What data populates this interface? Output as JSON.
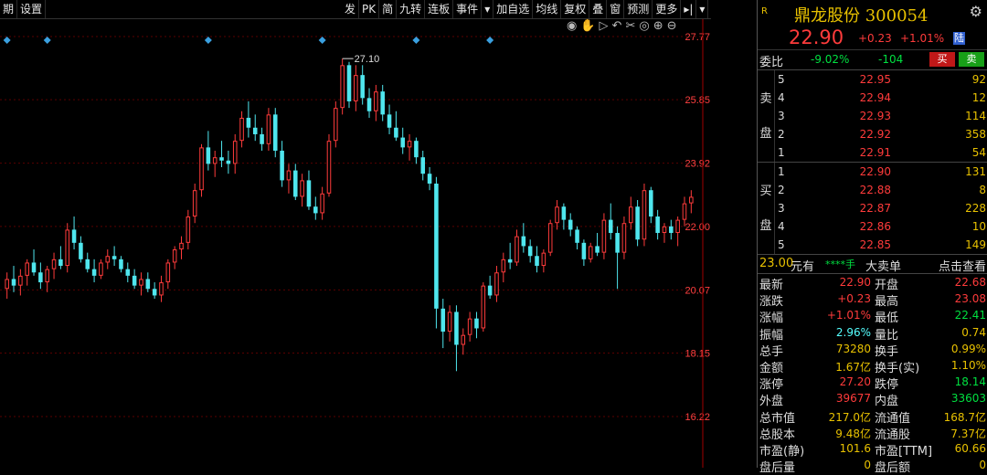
{
  "toolbar": {
    "left": [
      "期",
      "设置"
    ],
    "right": [
      "发",
      "PK",
      "简",
      "九转",
      "连板",
      "事件",
      "▾",
      "加自选",
      "均线",
      "复权",
      "叠",
      "窗",
      "预测",
      "更多",
      "▸|",
      "▾"
    ]
  },
  "chart_controls": [
    "eye-icon",
    "hand-icon",
    "play-icon",
    "undo-icon",
    "cut-icon",
    "target-icon",
    "zoom-in-icon",
    "zoom-out-icon"
  ],
  "chart_data": {
    "type": "candlestick",
    "y_ticks": [
      "27.77",
      "25.85",
      "23.92",
      "22.00",
      "20.07",
      "18.15",
      "16.22"
    ],
    "ylim": [
      16.22,
      27.77
    ],
    "max_marker": "27.10",
    "colors": {
      "up": "#ff3b3b",
      "down": "#4fe6ee",
      "grid": "#5a0000"
    },
    "candles": [
      [
        20.1,
        20.6,
        19.8,
        20.4
      ],
      [
        20.4,
        20.8,
        20.0,
        20.2
      ],
      [
        20.2,
        20.7,
        19.9,
        20.5
      ],
      [
        20.5,
        21.0,
        20.2,
        20.9
      ],
      [
        20.9,
        21.3,
        20.5,
        20.6
      ],
      [
        20.6,
        20.9,
        20.1,
        20.3
      ],
      [
        20.3,
        20.8,
        20.0,
        20.7
      ],
      [
        20.7,
        21.2,
        20.4,
        21.0
      ],
      [
        21.0,
        21.4,
        20.7,
        20.8
      ],
      [
        20.8,
        22.1,
        20.6,
        21.9
      ],
      [
        21.9,
        22.3,
        21.3,
        21.5
      ],
      [
        21.5,
        21.7,
        20.9,
        21.0
      ],
      [
        21.0,
        21.2,
        20.6,
        20.7
      ],
      [
        20.7,
        21.0,
        20.3,
        20.5
      ],
      [
        20.5,
        21.0,
        20.4,
        20.9
      ],
      [
        20.9,
        21.3,
        20.7,
        21.1
      ],
      [
        21.1,
        21.4,
        20.8,
        21.0
      ],
      [
        21.0,
        21.1,
        20.6,
        20.7
      ],
      [
        20.7,
        20.9,
        20.3,
        20.5
      ],
      [
        20.5,
        20.7,
        20.1,
        20.2
      ],
      [
        20.2,
        20.6,
        19.9,
        20.4
      ],
      [
        20.4,
        20.6,
        20.0,
        20.1
      ],
      [
        20.1,
        20.3,
        19.8,
        19.9
      ],
      [
        19.9,
        20.5,
        19.7,
        20.3
      ],
      [
        20.3,
        21.0,
        20.1,
        20.9
      ],
      [
        20.9,
        21.4,
        20.7,
        21.3
      ],
      [
        21.3,
        21.7,
        21.0,
        21.5
      ],
      [
        21.5,
        22.5,
        21.3,
        22.3
      ],
      [
        22.3,
        23.3,
        22.1,
        23.1
      ],
      [
        23.1,
        24.5,
        22.9,
        24.4
      ],
      [
        24.4,
        24.9,
        23.7,
        23.9
      ],
      [
        23.9,
        24.3,
        23.5,
        24.1
      ],
      [
        24.1,
        24.6,
        23.8,
        24.0
      ],
      [
        24.0,
        24.3,
        23.6,
        23.9
      ],
      [
        23.9,
        24.8,
        23.6,
        24.6
      ],
      [
        24.6,
        25.5,
        24.4,
        25.3
      ],
      [
        25.3,
        25.8,
        24.7,
        25.0
      ],
      [
        25.0,
        25.4,
        24.6,
        24.8
      ],
      [
        24.8,
        25.0,
        24.3,
        24.5
      ],
      [
        24.5,
        25.6,
        24.3,
        25.4
      ],
      [
        25.4,
        25.6,
        24.1,
        24.3
      ],
      [
        24.3,
        24.6,
        23.2,
        23.4
      ],
      [
        23.4,
        23.9,
        23.0,
        23.7
      ],
      [
        23.7,
        23.9,
        22.8,
        22.9
      ],
      [
        22.9,
        23.6,
        22.6,
        23.4
      ],
      [
        23.4,
        23.7,
        22.5,
        22.6
      ],
      [
        22.6,
        22.9,
        22.2,
        22.4
      ],
      [
        22.4,
        23.2,
        22.2,
        23.0
      ],
      [
        23.0,
        24.8,
        22.9,
        24.6
      ],
      [
        24.6,
        25.8,
        24.4,
        25.6
      ],
      [
        25.6,
        27.1,
        25.4,
        26.9
      ],
      [
        26.9,
        27.0,
        25.6,
        25.8
      ],
      [
        25.8,
        26.9,
        25.5,
        26.6
      ],
      [
        26.6,
        26.9,
        25.7,
        25.9
      ],
      [
        25.9,
        26.2,
        25.3,
        25.5
      ],
      [
        25.5,
        26.3,
        25.2,
        26.1
      ],
      [
        26.1,
        26.3,
        25.2,
        25.4
      ],
      [
        25.4,
        25.7,
        24.8,
        25.0
      ],
      [
        25.0,
        25.5,
        24.6,
        24.7
      ],
      [
        24.7,
        25.0,
        24.2,
        24.4
      ],
      [
        24.4,
        24.8,
        24.0,
        24.6
      ],
      [
        24.6,
        24.7,
        23.9,
        24.1
      ],
      [
        24.1,
        24.3,
        23.4,
        23.6
      ],
      [
        23.6,
        23.8,
        23.1,
        23.3
      ],
      [
        23.3,
        23.5,
        18.9,
        19.5
      ],
      [
        19.5,
        19.8,
        18.3,
        18.8
      ],
      [
        18.8,
        19.6,
        18.5,
        19.4
      ],
      [
        19.4,
        19.6,
        17.6,
        18.4
      ],
      [
        18.4,
        18.9,
        18.1,
        18.7
      ],
      [
        18.7,
        19.4,
        18.5,
        19.2
      ],
      [
        19.2,
        19.4,
        18.6,
        18.9
      ],
      [
        18.9,
        20.3,
        18.8,
        20.2
      ],
      [
        20.2,
        20.5,
        19.8,
        19.9
      ],
      [
        19.9,
        20.8,
        19.7,
        20.6
      ],
      [
        20.6,
        21.2,
        20.3,
        21.0
      ],
      [
        21.0,
        21.5,
        20.7,
        20.9
      ],
      [
        20.9,
        21.9,
        20.8,
        21.7
      ],
      [
        21.7,
        22.1,
        21.2,
        21.4
      ],
      [
        21.4,
        21.6,
        20.9,
        21.1
      ],
      [
        21.1,
        21.4,
        20.6,
        20.8
      ],
      [
        20.8,
        21.3,
        20.6,
        21.2
      ],
      [
        21.2,
        22.2,
        21.1,
        22.1
      ],
      [
        22.1,
        22.8,
        21.9,
        22.6
      ],
      [
        22.6,
        22.7,
        21.9,
        22.2
      ],
      [
        22.2,
        22.4,
        21.7,
        21.9
      ],
      [
        21.9,
        22.0,
        21.3,
        21.5
      ],
      [
        21.5,
        21.6,
        20.8,
        21.0
      ],
      [
        21.0,
        21.5,
        20.9,
        21.4
      ],
      [
        21.4,
        21.8,
        21.1,
        21.2
      ],
      [
        21.2,
        22.4,
        21.0,
        22.2
      ],
      [
        22.2,
        22.7,
        21.6,
        21.8
      ],
      [
        21.8,
        22.0,
        20.1,
        21.2
      ],
      [
        21.2,
        22.3,
        21.0,
        22.1
      ],
      [
        22.1,
        22.9,
        21.9,
        22.6
      ],
      [
        22.6,
        22.8,
        21.4,
        21.6
      ],
      [
        21.6,
        23.3,
        21.4,
        23.1
      ],
      [
        23.1,
        23.2,
        22.1,
        22.3
      ],
      [
        22.3,
        22.5,
        21.6,
        21.8
      ],
      [
        21.8,
        22.1,
        21.5,
        22.0
      ],
      [
        22.0,
        22.2,
        21.6,
        21.8
      ],
      [
        21.8,
        22.3,
        21.4,
        22.2
      ],
      [
        22.2,
        22.9,
        22.0,
        22.7
      ],
      [
        22.7,
        23.1,
        22.4,
        22.9
      ]
    ],
    "markers": [
      0,
      6,
      30,
      47,
      61,
      72
    ]
  },
  "stock": {
    "tag": "R",
    "name": "鼎龙股份",
    "code": "300054",
    "price": "22.90",
    "change": "+0.23",
    "pct": "+1.01%",
    "market": "陆"
  },
  "weibi": {
    "label": "委比",
    "ratio": "-9.02%",
    "diff": "-104",
    "buy": "买",
    "sell": "卖"
  },
  "asks": {
    "label": [
      "卖",
      "盘"
    ],
    "rows": [
      {
        "lvl": "5",
        "price": "22.95",
        "vol": "92"
      },
      {
        "lvl": "4",
        "price": "22.94",
        "vol": "12"
      },
      {
        "lvl": "3",
        "price": "22.93",
        "vol": "114"
      },
      {
        "lvl": "2",
        "price": "22.92",
        "vol": "358"
      },
      {
        "lvl": "1",
        "price": "22.91",
        "vol": "54"
      }
    ]
  },
  "bids": {
    "label": [
      "买",
      "盘"
    ],
    "rows": [
      {
        "lvl": "1",
        "price": "22.90",
        "vol": "131"
      },
      {
        "lvl": "2",
        "price": "22.88",
        "vol": "8"
      },
      {
        "lvl": "3",
        "price": "22.87",
        "vol": "228"
      },
      {
        "lvl": "4",
        "price": "22.86",
        "vol": "10"
      },
      {
        "lvl": "5",
        "price": "22.85",
        "vol": "149"
      }
    ]
  },
  "trade": {
    "price": "23.00",
    "unit": "元有",
    "hand": "****手",
    "big": "大卖单",
    "link": "点击查看"
  },
  "stats": [
    {
      "l1": "最新",
      "v1": "22.90",
      "c1": "red",
      "l2": "开盘",
      "v2": "22.68",
      "c2": "red"
    },
    {
      "l1": "涨跌",
      "v1": "+0.23",
      "c1": "red",
      "l2": "最高",
      "v2": "23.08",
      "c2": "red"
    },
    {
      "l1": "涨幅",
      "v1": "+1.01%",
      "c1": "red",
      "l2": "最低",
      "v2": "22.41",
      "c2": "green"
    },
    {
      "l1": "振幅",
      "v1": "2.96%",
      "c1": "cyan",
      "l2": "量比",
      "v2": "0.74",
      "c2": "yellow"
    },
    {
      "l1": "总手",
      "v1": "73280",
      "c1": "yellow",
      "l2": "换手",
      "v2": "0.99%",
      "c2": "yellow"
    },
    {
      "l1": "金额",
      "v1": "1.67亿",
      "c1": "yellow",
      "l2": "换手(实)",
      "v2": "1.10%",
      "c2": "yellow"
    },
    {
      "l1": "涨停",
      "v1": "27.20",
      "c1": "red",
      "l2": "跌停",
      "v2": "18.14",
      "c2": "green"
    },
    {
      "l1": "外盘",
      "v1": "39677",
      "c1": "red",
      "l2": "内盘",
      "v2": "33603",
      "c2": "green"
    },
    {
      "l1": "总市值",
      "v1": "217.0亿",
      "c1": "yellow",
      "l2": "流通值",
      "v2": "168.7亿",
      "c2": "yellow"
    },
    {
      "l1": "总股本",
      "v1": "9.48亿",
      "c1": "yellow",
      "l2": "流通股",
      "v2": "7.37亿",
      "c2": "yellow"
    },
    {
      "l1": "市盈(静)",
      "v1": "101.6",
      "c1": "yellow",
      "l2": "市盈[TTM]",
      "v2": "60.66",
      "c2": "yellow"
    },
    {
      "l1": "盘后量",
      "v1": "0",
      "c1": "yellow",
      "l2": "盘后额",
      "v2": "0",
      "c2": "yellow"
    }
  ]
}
